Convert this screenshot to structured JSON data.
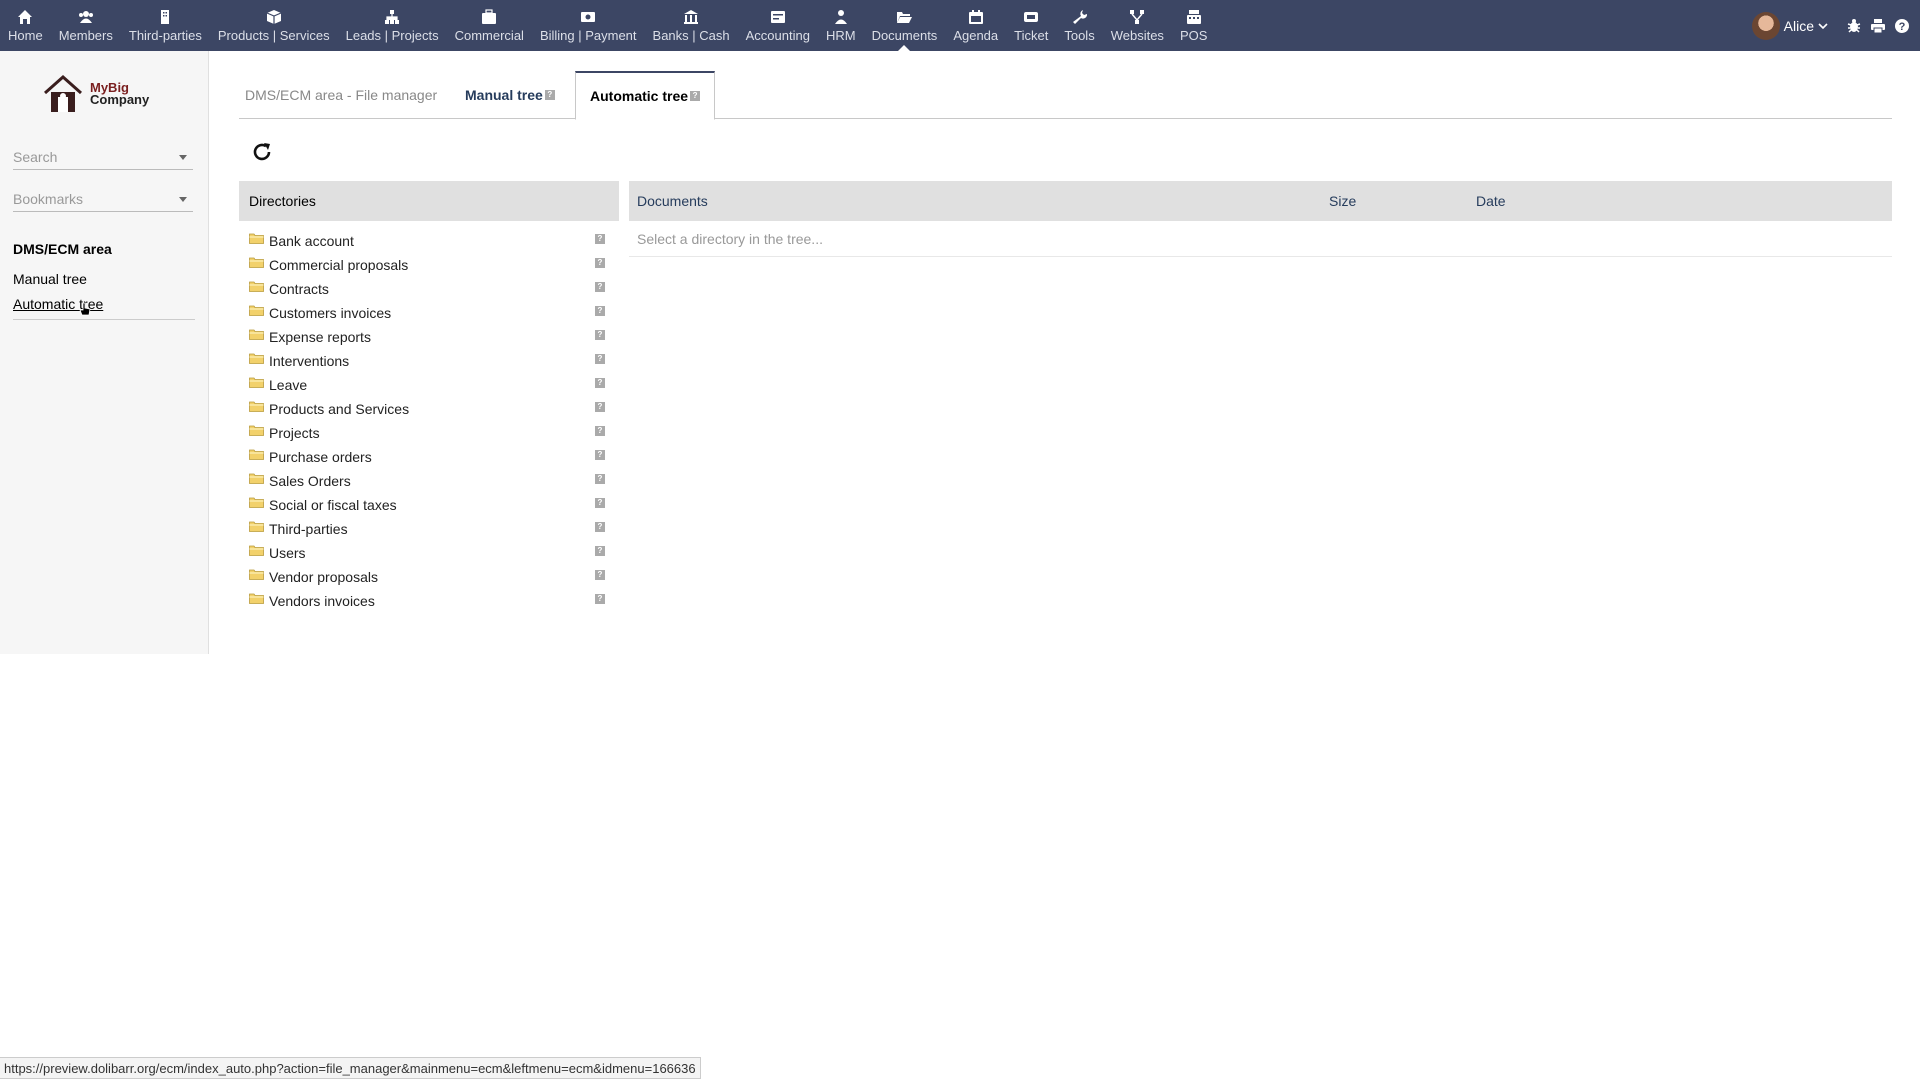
{
  "topbar": {
    "menu": [
      {
        "label": "Home",
        "icon": "home-icon"
      },
      {
        "label": "Members",
        "icon": "members-icon"
      },
      {
        "label": "Third-parties",
        "icon": "building-icon"
      },
      {
        "label": "Products | Services",
        "icon": "cube-icon"
      },
      {
        "label": "Leads | Projects",
        "icon": "sitemap-icon"
      },
      {
        "label": "Commercial",
        "icon": "suitcase-icon"
      },
      {
        "label": "Billing | Payment",
        "icon": "money-icon"
      },
      {
        "label": "Banks | Cash",
        "icon": "bank-icon"
      },
      {
        "label": "Accounting",
        "icon": "accounting-icon"
      },
      {
        "label": "HRM",
        "icon": "user-tie-icon"
      },
      {
        "label": "Documents",
        "icon": "folder-open-icon"
      },
      {
        "label": "Agenda",
        "icon": "calendar-icon"
      },
      {
        "label": "Ticket",
        "icon": "ticket-icon"
      },
      {
        "label": "Tools",
        "icon": "wrench-icon"
      },
      {
        "label": "Websites",
        "icon": "network-icon"
      },
      {
        "label": "POS",
        "icon": "cash-register-icon"
      }
    ],
    "active": "Documents",
    "user": "Alice"
  },
  "sidebar": {
    "logo_line1": "MyBig",
    "logo_line2": "Company",
    "search_placeholder": "Search",
    "bookmarks_placeholder": "Bookmarks",
    "section_title": "DMS/ECM area",
    "links": [
      "Manual tree",
      "Automatic tree"
    ]
  },
  "tabs": {
    "label": "DMS/ECM area - File manager",
    "manual": "Manual tree",
    "automatic": "Automatic tree"
  },
  "directories": {
    "header": "Directories",
    "items": [
      "Bank account",
      "Commercial proposals",
      "Contracts",
      "Customers invoices",
      "Expense reports",
      "Interventions",
      "Leave",
      "Products and Services",
      "Projects",
      "Purchase orders",
      "Sales Orders",
      "Social or fiscal taxes",
      "Third-parties",
      "Users",
      "Vendor proposals",
      "Vendors invoices"
    ]
  },
  "documents": {
    "col_documents": "Documents",
    "col_size": "Size",
    "col_date": "Date",
    "empty_text": "Select a directory in the tree..."
  },
  "statusbar": {
    "url": "https://preview.dolibarr.org/ecm/index_auto.php?action=file_manager&mainmenu=ecm&leftmenu=ecm&idmenu=166636"
  },
  "colors": {
    "topbar": "#3c4664",
    "header_bg": "#e0e0e0",
    "folder": "#f2d16b"
  }
}
